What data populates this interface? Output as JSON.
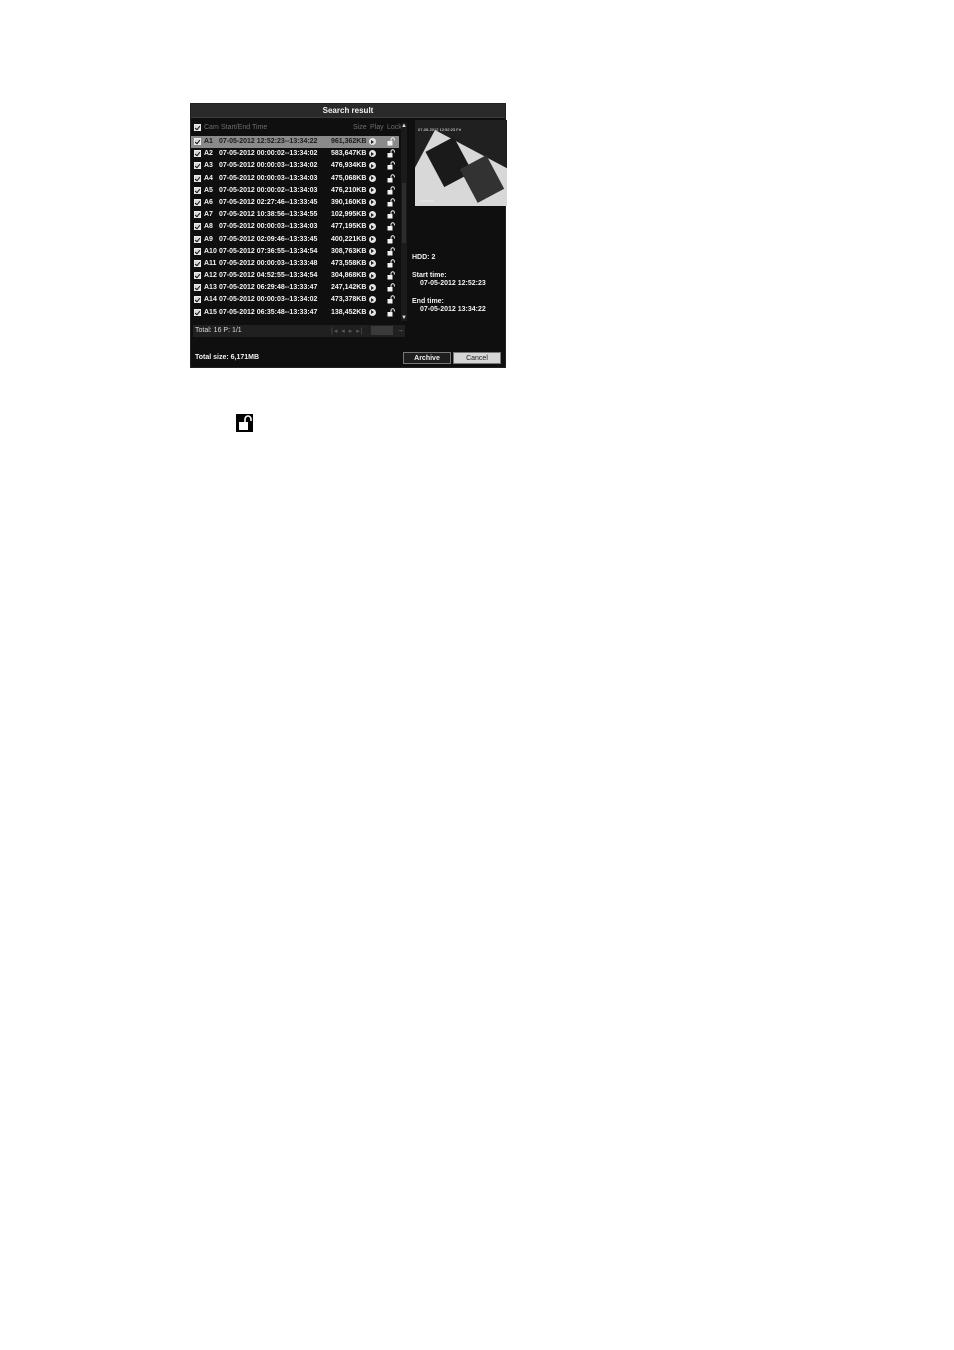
{
  "window": {
    "title": "Search result"
  },
  "list": {
    "headers": {
      "cam": "Cam",
      "time": "Start/End Time",
      "size": "Size",
      "play": "Play",
      "lock": "Lock"
    },
    "rows": [
      {
        "cam": "A1",
        "time": "07-05-2012 12:52:23--13:34:22",
        "size": "961,362KB",
        "selected": true
      },
      {
        "cam": "A2",
        "time": "07-05-2012 00:00:02--13:34:02",
        "size": "583,647KB"
      },
      {
        "cam": "A3",
        "time": "07-05-2012 00:00:03--13:34:02",
        "size": "476,934KB"
      },
      {
        "cam": "A4",
        "time": "07-05-2012 00:00:03--13:34:03",
        "size": "475,068KB"
      },
      {
        "cam": "A5",
        "time": "07-05-2012 00:00:02--13:34:03",
        "size": "476,210KB"
      },
      {
        "cam": "A6",
        "time": "07-05-2012 02:27:46--13:33:45",
        "size": "390,160KB"
      },
      {
        "cam": "A7",
        "time": "07-05-2012 10:38:56--13:34:55",
        "size": "102,995KB"
      },
      {
        "cam": "A8",
        "time": "07-05-2012 00:00:03--13:34:03",
        "size": "477,195KB"
      },
      {
        "cam": "A9",
        "time": "07-05-2012 02:09:46--13:33:45",
        "size": "400,221KB"
      },
      {
        "cam": "A10",
        "time": "07-05-2012 07:36:55--13:34:54",
        "size": "308,763KB"
      },
      {
        "cam": "A11",
        "time": "07-05-2012 00:00:03--13:33:48",
        "size": "473,558KB"
      },
      {
        "cam": "A12",
        "time": "07-05-2012 04:52:55--13:34:54",
        "size": "304,868KB"
      },
      {
        "cam": "A13",
        "time": "07-05-2012 06:29:48--13:33:47",
        "size": "247,142KB"
      },
      {
        "cam": "A14",
        "time": "07-05-2012 00:00:03--13:34:02",
        "size": "473,378KB"
      },
      {
        "cam": "A15",
        "time": "07-05-2012 06:35:48--13:33:47",
        "size": "138,452KB"
      }
    ]
  },
  "footer": {
    "total": "Total: 16  P: 1/1",
    "pager": "|◂ ◂ ▸ ▸|",
    "go": "→"
  },
  "preview": {
    "osd": "07-05-2012 12:52:23 Fri",
    "camera_label": "Camera"
  },
  "info": {
    "hdd": "HDD: 2",
    "start_label": "Start time:",
    "start_value": "07-05-2012 12:52:23",
    "end_label": "End time:",
    "end_value": "07-05-2012 13:34:22"
  },
  "bottom": {
    "total_size": "Total size: 6,171MB",
    "archive": "Archive",
    "cancel": "Cancel"
  },
  "icons": {
    "play": "play-icon",
    "lock": "unlock-icon",
    "legend": "unlock-icon"
  }
}
